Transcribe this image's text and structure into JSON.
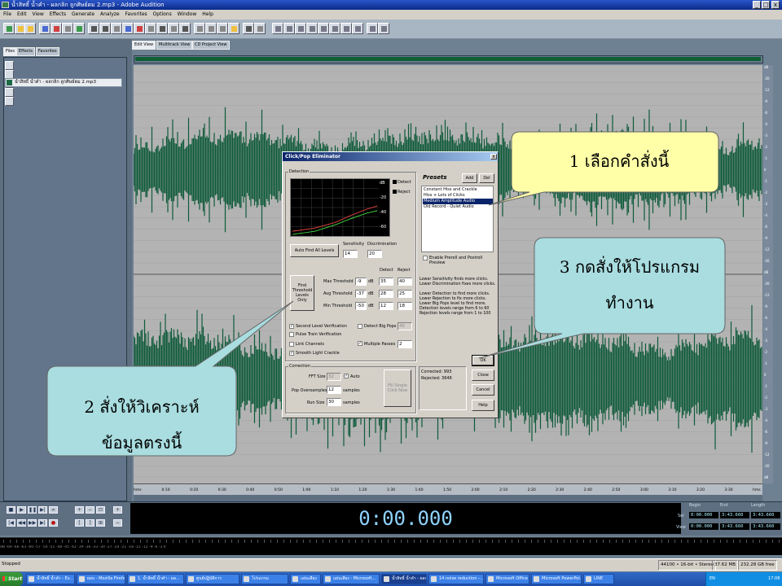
{
  "window": {
    "title": "น้ำสิทธิ์ น้ำคำ - ผลกลิก ลูกศิษย์ตม 2.mp3 - Adobe Audition",
    "min": "_",
    "max": "□",
    "close": "x"
  },
  "menu": [
    "File",
    "Edit",
    "View",
    "Effects",
    "Generate",
    "Analyze",
    "Favorites",
    "Options",
    "Window",
    "Help"
  ],
  "left_tabs": [
    "Files",
    "Effects",
    "Favorites"
  ],
  "file_item": "น้ำสิทธิ์ น้ำคำ - ผลกลิก ลูกศิษย์ตม 2.mp3",
  "main_tabs": [
    "Edit View",
    "Multitrack View",
    "CD Project View"
  ],
  "db_scale": [
    "dB",
    "-20",
    "-12",
    "-9",
    "-6",
    "-4",
    "-3",
    "-2",
    "-1",
    "0",
    "-1",
    "-2",
    "-3",
    "-4",
    "-6",
    "-9",
    "-12",
    "-20",
    "dB",
    "-20",
    "-12",
    "-9",
    "-6",
    "-4",
    "-3",
    "-2",
    "-1",
    "0",
    "-1",
    "-2",
    "-3",
    "-4",
    "-6",
    "-9",
    "-12",
    "-20",
    "dB"
  ],
  "timeline_labels": [
    "hms",
    "0:10",
    "0:20",
    "0:30",
    "0:40",
    "0:50",
    "1:00",
    "1:10",
    "1:20",
    "1:30",
    "1:40",
    "1:50",
    "2:00",
    "2:10",
    "2:20",
    "2:30",
    "2:40",
    "2:50",
    "3:00",
    "3:10",
    "3:20",
    "3:30",
    "hms"
  ],
  "time_display": "0:00.000",
  "selview": {
    "headers": [
      "Begin",
      "End",
      "Length"
    ],
    "sel_label": "Sel",
    "view_label": "View",
    "sel": [
      "0:00.000",
      "3:43.660",
      "3:43.660"
    ],
    "view": [
      "0:00.000",
      "3:43.660",
      "3:43.660"
    ]
  },
  "level_ticks": "dB -69 -66 -63 -60 -57 -54 -51 -48 -45 -42 -39 -36 -33 -30 -27 -24 -21 -18 -15 -12 -9 -6 -3 0",
  "status": {
    "left": "Stopped",
    "format": "44100 • 16-bit • Stereo",
    "size": "37.62 MB",
    "free": "232.28 GB free"
  },
  "taskbar": {
    "start": "Start",
    "tasks": [
      "น้ำสิทธิ์ น้ำคำ - Ev...",
      "ผอบ - Mozilla Firefox",
      "1. น้ำสิทธิ์ น้ำคำ - ผล...",
      "ศูนย์ปฏิบัติการ",
      "โปรแกรม",
      "แผ่นเสียง",
      "แผ่นเสียง - Microsoft...",
      "น้ำสิทธิ์ น้ำคำ - ผลก...",
      "14 noise reduction -...",
      "Microsoft Office Pic...",
      "Microsoft PowerPoi...",
      "LINE"
    ],
    "clock": "17:08",
    "lang": "EN"
  },
  "dialog": {
    "title": "Click/Pop Eliminator",
    "close": "x",
    "detection_label": "Detection",
    "graph_legend": [
      "Detect",
      "Reject"
    ],
    "graph_axis": [
      "dB",
      "-20",
      "-40",
      "-60"
    ],
    "auto_find": "Auto Find All Levels",
    "sensitivity_label": "Sensitivity",
    "sensitivity": "14",
    "discrimination_label": "Discrimination",
    "discrimination": "20",
    "find_threshold": "Find Threshold Levels Only",
    "detect_col": "Detect",
    "reject_col": "Reject",
    "thresholds": [
      {
        "label": "Max Threshold",
        "value": "-9",
        "unit": "dB",
        "detect": "35",
        "reject": "40"
      },
      {
        "label": "Avg Threshold",
        "value": "-37",
        "unit": "dB",
        "detect": "28",
        "reject": "25"
      },
      {
        "label": "Min Threshold",
        "value": "-50",
        "unit": "dB",
        "detect": "12",
        "reject": "18"
      }
    ],
    "checks": {
      "second_level": "Second Level Verification",
      "pulse_train": "Pulse Train Verification",
      "link_channels": "Link Channels",
      "smooth_light": "Smooth Light Crackle",
      "detect_big_pops": "Detect Big Pops",
      "big_pops_value": "45",
      "multiple_passes": "Multiple Passes",
      "passes_value": "2"
    },
    "correction_label": "Correction",
    "fft_label": "FFT Size",
    "fft_value": "32",
    "auto_label": "Auto",
    "pop_over_label": "Pop Oversamples",
    "pop_over_value": "12",
    "run_size_label": "Run Size",
    "run_size_value": "30",
    "samples": "samples",
    "fill_single": "Fill Single Click Now",
    "presets_label": "Presets",
    "add": "Add",
    "del": "Del",
    "presets": [
      "Constant Hiss and Crackle",
      "Hiss + Lots of Clicks",
      "Medium Amplitude Audio",
      "Old Record - Quiet Audio"
    ],
    "selected_preset": 2,
    "preroll": "Enable Preroll and Postroll Preview",
    "info": [
      "Lower Sensitivity finds more clicks.",
      "Lower Discrimination fixes more clicks.",
      "",
      "Lower Detection to find more clicks.",
      "Lower Rejection to fix more clicks.",
      "Lower Big Pops level to find more.",
      "Detection levels range from 6 to 60",
      "Rejection levels range from 1 to 100"
    ],
    "corrected": "Corrected: 993",
    "rejected": "Rejected: 3646",
    "ok": "OK",
    "close_btn": "Close",
    "cancel": "Cancel",
    "help": "Help"
  },
  "callouts": {
    "c1": "1 เลือกคำสั่งนี้",
    "c2_line1": "2 สั่งให้วิเคราะห์",
    "c2_line2": "ข้อมูลตรงนี้",
    "c3_line1": "3 กดสั่งให้โปรแกรม",
    "c3_line2": "ทำงาน"
  },
  "colors": {
    "wave": "#0e5a3a",
    "callout1": "#ffffa8",
    "callout_blue": "#a9dde0"
  }
}
